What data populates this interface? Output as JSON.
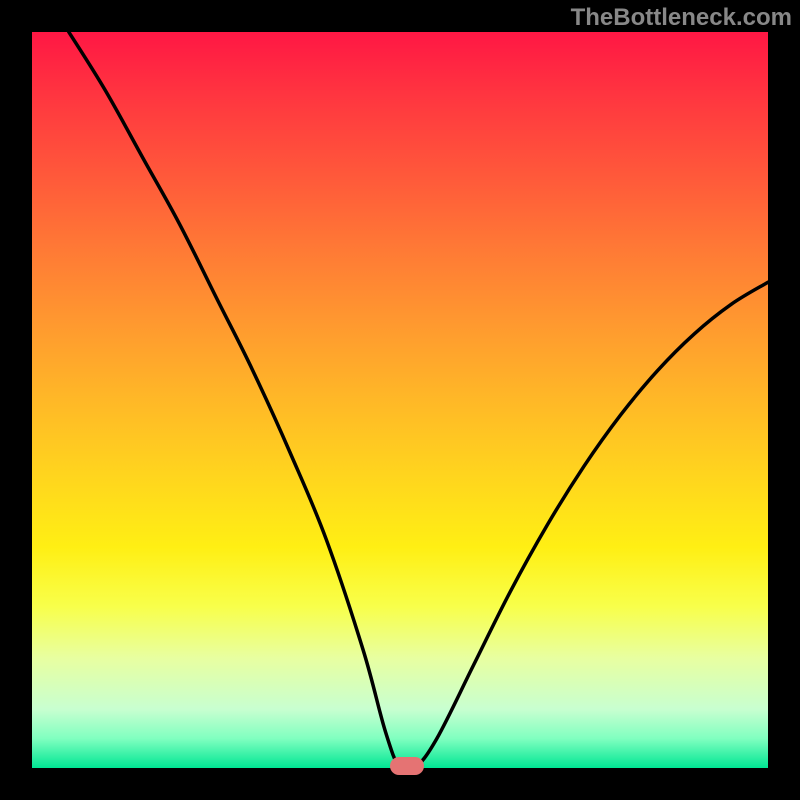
{
  "watermark": "TheBottleneck.com",
  "chart_data": {
    "type": "line",
    "title": "",
    "xlabel": "",
    "ylabel": "",
    "xlim": [
      0,
      100
    ],
    "ylim": [
      0,
      100
    ],
    "grid": false,
    "legend": false,
    "background_gradient": {
      "top_color": "#ff1744",
      "bottom_color": "#00e693",
      "description": "vertical red-to-green heat gradient"
    },
    "series": [
      {
        "name": "bottleneck-curve",
        "color": "#000000",
        "x": [
          5,
          10,
          15,
          20,
          25,
          30,
          35,
          40,
          45,
          48,
          50,
          52,
          55,
          60,
          65,
          70,
          75,
          80,
          85,
          90,
          95,
          100
        ],
        "values": [
          100,
          92,
          83,
          74,
          64,
          54,
          43,
          31,
          16,
          5,
          0,
          0,
          4,
          14,
          24,
          33,
          41,
          48,
          54,
          59,
          63,
          66
        ]
      }
    ],
    "optimal_marker": {
      "x": 51,
      "y": 0,
      "color": "#e57373"
    }
  }
}
